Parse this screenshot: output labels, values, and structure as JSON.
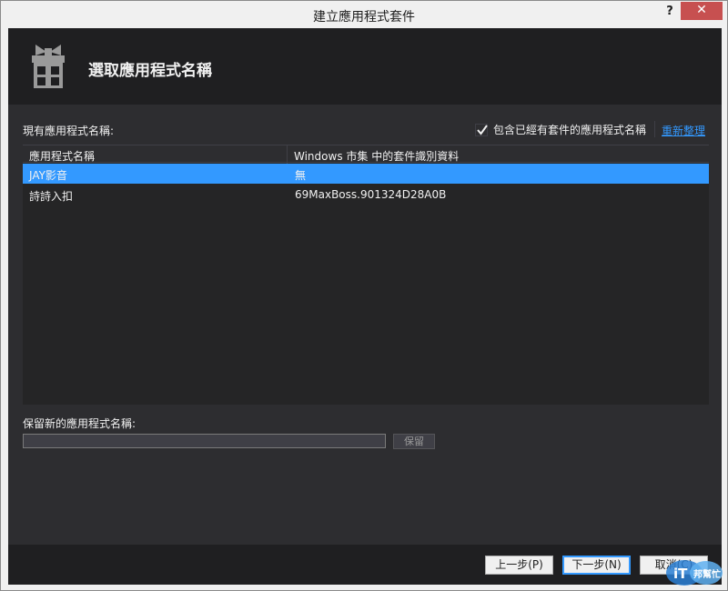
{
  "window": {
    "title": "建立應用程式套件"
  },
  "titlebar": {
    "help_label": "?",
    "close_label": "✕"
  },
  "header": {
    "title": "選取應用程式名稱",
    "icon": "gift-icon"
  },
  "main": {
    "existing_label": "現有應用程式名稱:",
    "include_checkbox": {
      "label": "包含已經有套件的應用程式名稱",
      "checked": true
    },
    "refresh_link": "重新整理",
    "list": {
      "columns": [
        "應用程式名稱",
        "Windows 市集 中的套件識別資料"
      ],
      "rows": [
        {
          "name": "JAY影音",
          "package_id": "無",
          "selected": true
        },
        {
          "name": "詩詩入扣",
          "package_id": "69MaxBoss.901324D28A0B",
          "selected": false
        }
      ]
    },
    "reserve_label": "保留新的應用程式名稱:",
    "reserve_input": {
      "value": "",
      "placeholder": ""
    },
    "reserve_button": "保留"
  },
  "footer": {
    "prev_button": "上一步(P)",
    "next_button": "下一步(N)",
    "cancel_button": "取消(C)"
  },
  "watermark": {
    "text": "iT邦幫忙"
  },
  "colors": {
    "accent": "#3399ff",
    "dark_bg": "#2d2d30",
    "header_bg": "#1f1f21",
    "close_red": "#c75050"
  }
}
